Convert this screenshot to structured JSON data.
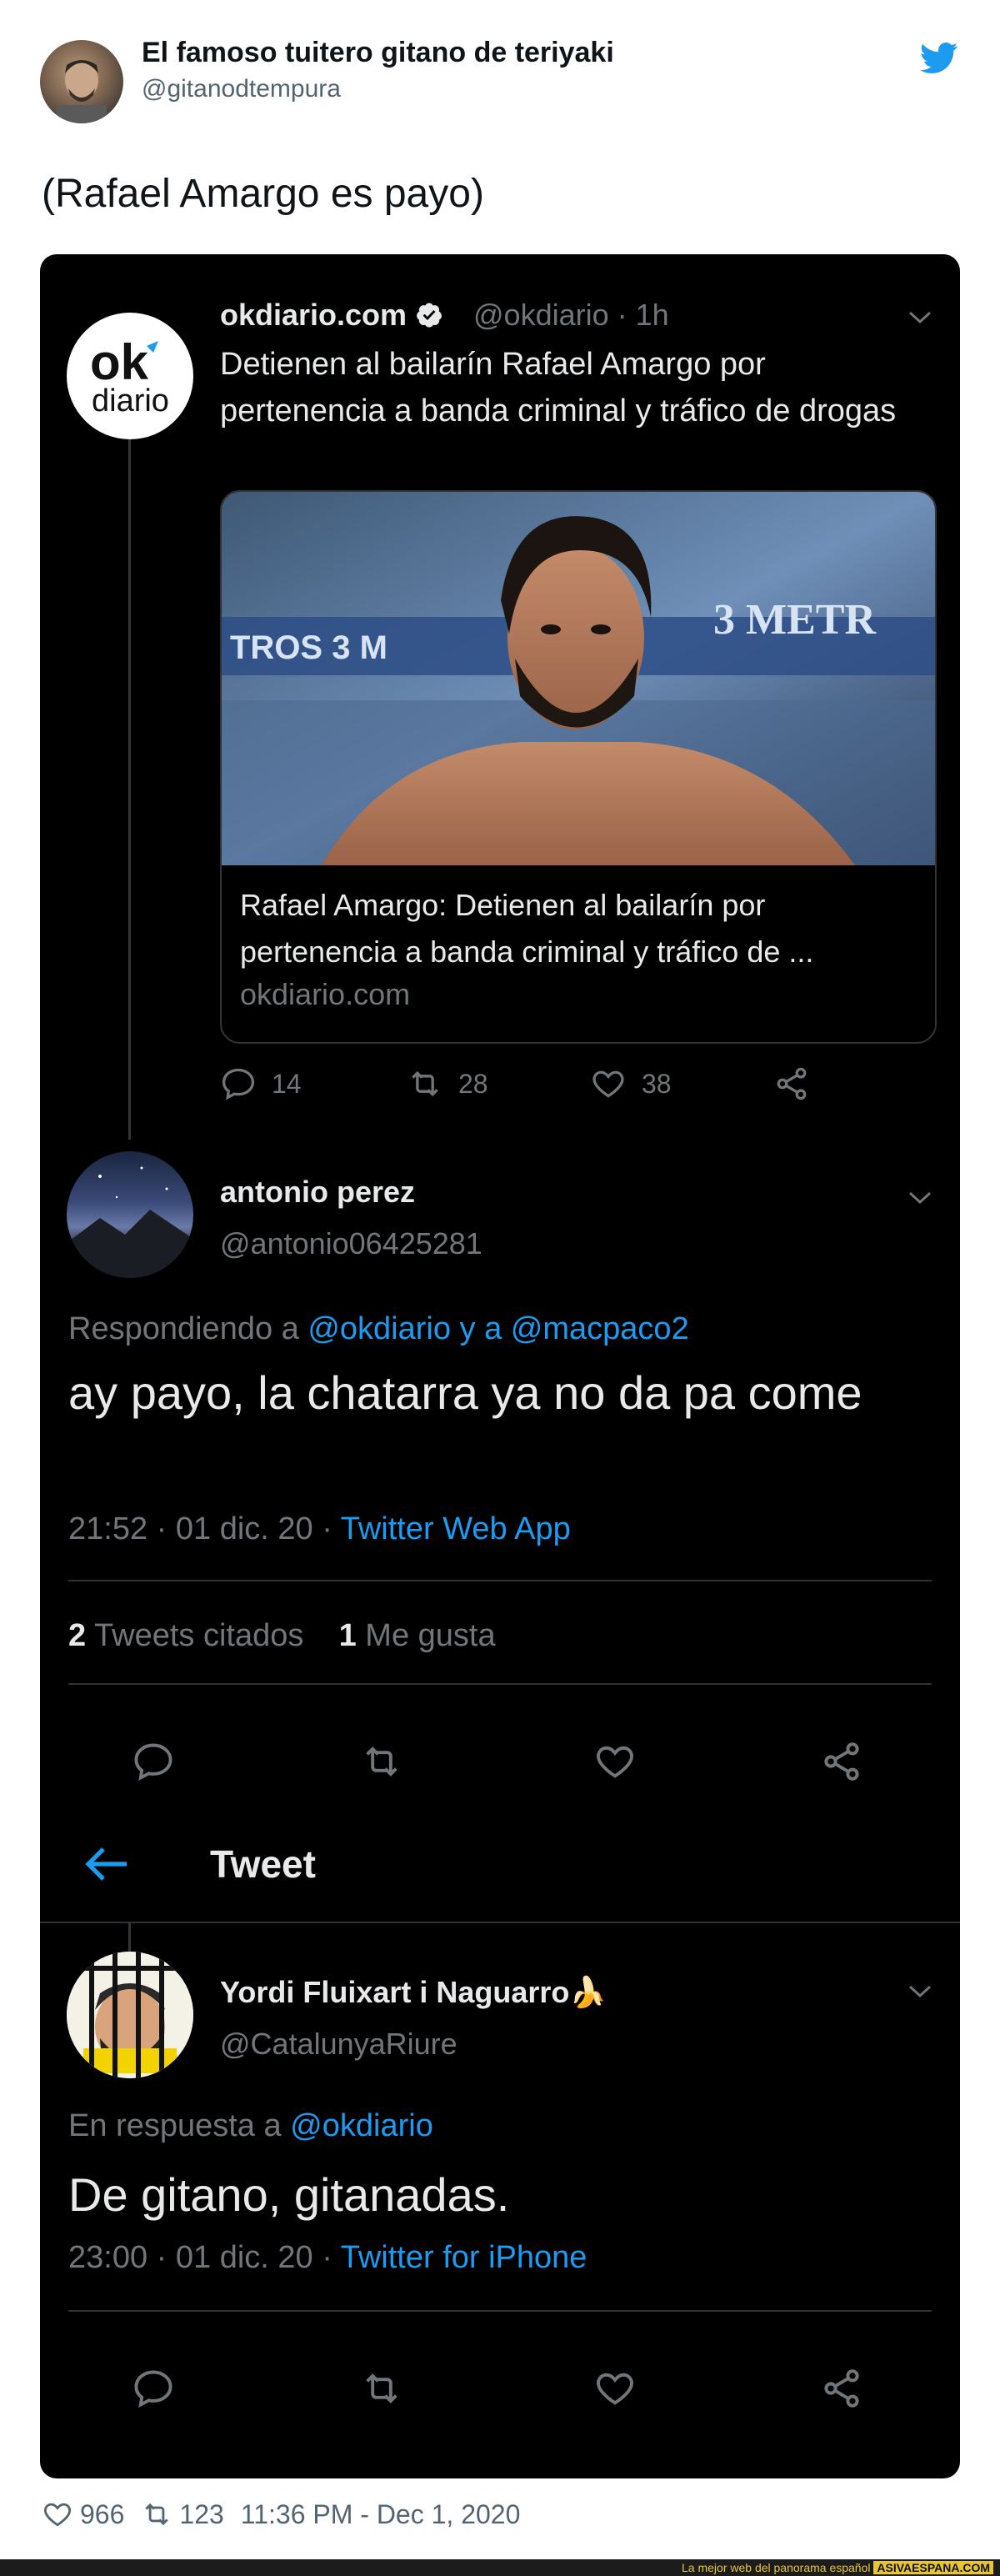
{
  "outer_tweet": {
    "author_name": "El famoso tuitero gitano de teriyaki",
    "author_handle": "@gitanodtempura",
    "text": "(Rafael Amargo es payo)",
    "likes": "966",
    "retweets": "123",
    "timestamp": "11:36 PM - Dec 1, 2020"
  },
  "quoted_thread": {
    "okdiario": {
      "logo_top": "ok",
      "logo_bottom": "diario",
      "name": "okdiario.com",
      "handle_time": "@okdiario · 1h",
      "text": "Detienen al bailarín Rafael Amargo por pertenencia a banda criminal y tráfico de drogas",
      "link_title": "Rafael Amargo: Detienen al bailarín por pertenencia a banda criminal y tráfico de ...",
      "link_domain": "okdiario.com",
      "photo_sign_left": "TROS 3 M",
      "photo_sign_right": "3 METR",
      "replies": "14",
      "retweets": "28",
      "likes": "38"
    },
    "antonio": {
      "name": "antonio perez",
      "handle": "@antonio06425281",
      "reply_prefix": "Respondiendo a ",
      "reply_to": "@okdiario y a @macpaco2",
      "text": "ay payo, la chatarra ya no da pa come",
      "time": "21:52 · 01 dic. 20 · ",
      "source": "Twitter Web App",
      "quote_count": "2",
      "quote_label": "Tweets citados",
      "like_count": "1",
      "like_label": "Me gusta"
    },
    "header": {
      "title": "Tweet"
    },
    "yordi": {
      "name": "Yordi Fluixart i Naguarro",
      "name_emoji": "🍌",
      "handle": "@CatalunyaRiure",
      "reply_prefix": "En respuesta a ",
      "reply_to": "@okdiario",
      "text": "De gitano, gitanadas.",
      "time": "23:00 · 01 dic. 20 · ",
      "source": "Twitter for iPhone"
    }
  },
  "banner": {
    "tagline": "La mejor web del panorama español",
    "site": "ASIVAESPANA.COM"
  },
  "colors": {
    "accent": "#1d9bf0",
    "dark_bg": "#000000",
    "text_light": "#e7e9ea",
    "text_gray": "#71767b"
  },
  "icons": [
    "twitter-bird-icon",
    "verified-badge-icon",
    "chevron-down-icon",
    "reply-icon",
    "retweet-icon",
    "like-icon",
    "share-icon",
    "back-arrow-icon"
  ]
}
